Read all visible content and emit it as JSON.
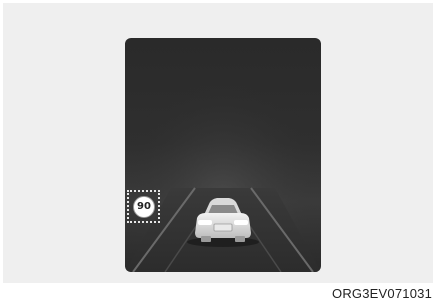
{
  "display": {
    "speed_limit_value": "90",
    "code_label": "ORG3EV071031"
  },
  "icons": {
    "speed_limit_sign": "speed-limit-sign-icon",
    "vehicle_ahead": "car-rear-icon"
  },
  "colors": {
    "panel_background": "#2d2d2d",
    "frame_background": "#efefef",
    "sign_background": "#ffffff",
    "selection_outline": "#e6e6e6"
  }
}
